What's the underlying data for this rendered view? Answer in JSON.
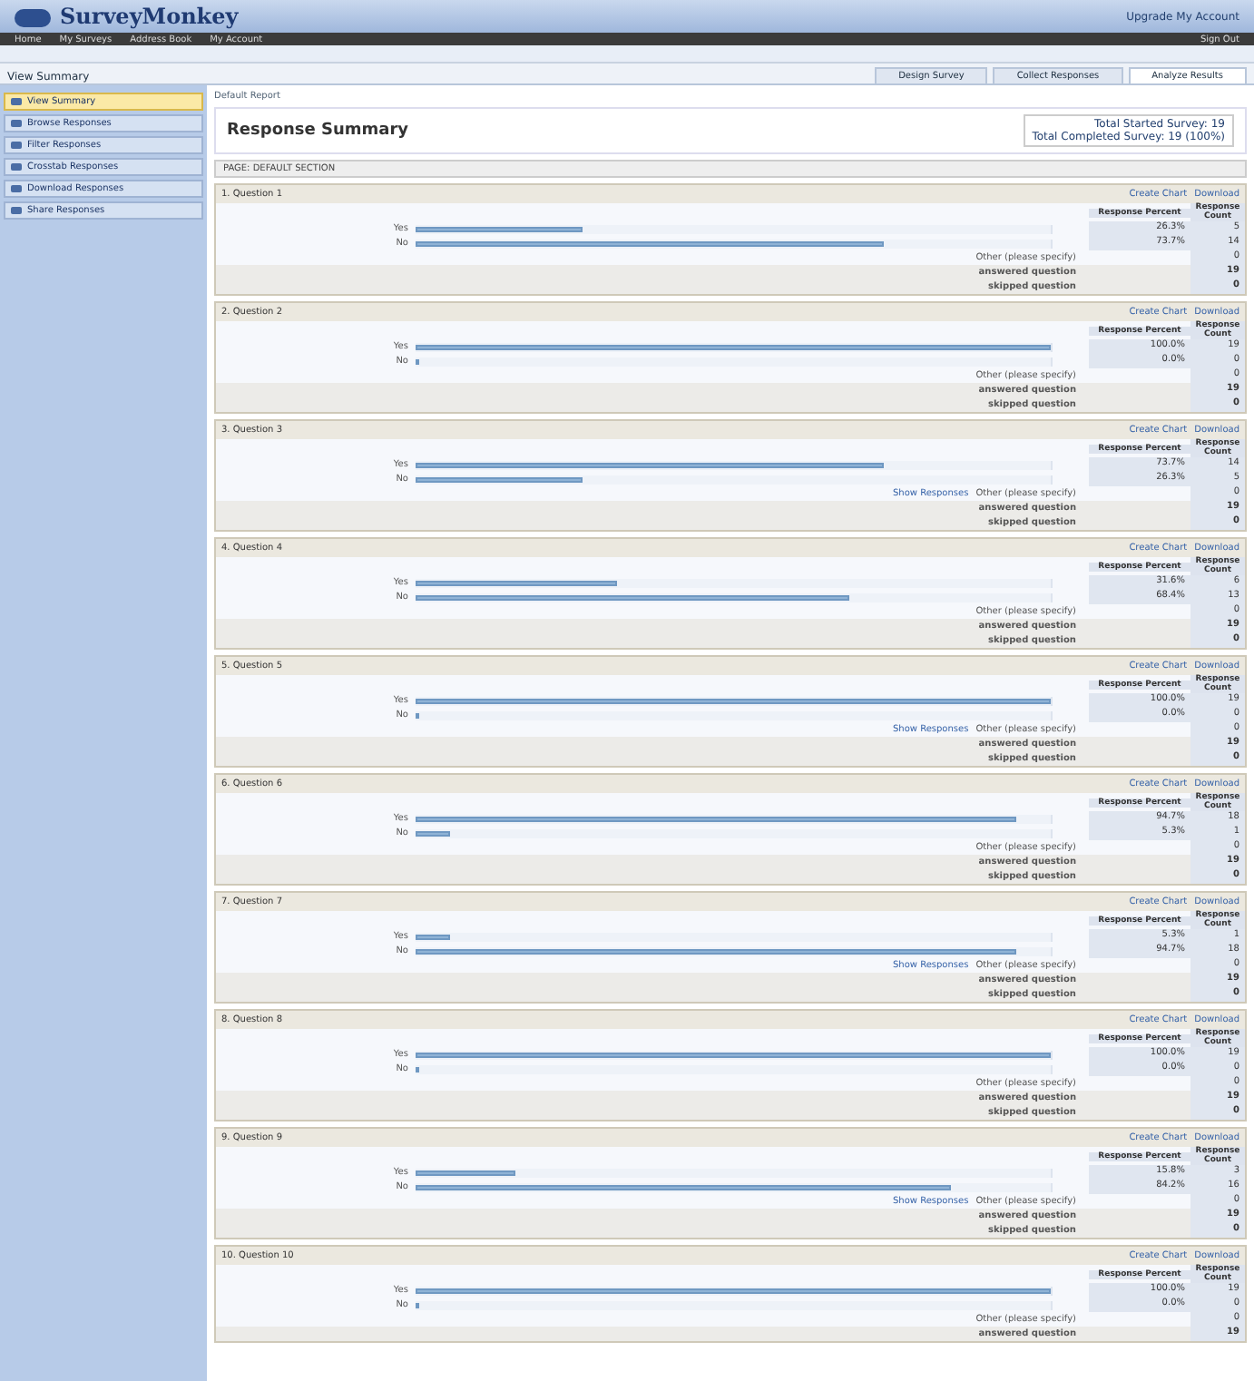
{
  "header": {
    "logo": "SurveyMonkey",
    "account": "Upgrade My Account",
    "nav": [
      "Home",
      "My Surveys",
      "Address Book",
      "My Account"
    ],
    "signout": "Sign Out"
  },
  "survey": {
    "title": "View Summary",
    "tabs": [
      {
        "label": "Design Survey",
        "selected": false
      },
      {
        "label": "Collect Responses",
        "selected": false
      },
      {
        "label": "Analyze Results",
        "selected": true
      }
    ]
  },
  "sidebar": {
    "items": [
      {
        "label": "View Summary",
        "selected": true
      },
      {
        "label": "Browse Responses",
        "selected": false
      },
      {
        "label": "Filter Responses",
        "selected": false
      },
      {
        "label": "Crosstab Responses",
        "selected": false
      },
      {
        "label": "Download Responses",
        "selected": false
      },
      {
        "label": "Share Responses",
        "selected": false
      }
    ]
  },
  "breadcrumb": "Default Report",
  "page_title": "Response Summary",
  "totals": [
    "Total Started Survey: 19",
    "Total Completed Survey: 19 (100%)"
  ],
  "page_label": "PAGE: DEFAULT SECTION",
  "questions": [
    {
      "title": "1. Question 1",
      "chart_link": "Create Chart",
      "download_link": "Download",
      "percent_header": "Response Percent",
      "count_header": "Response Count",
      "options": [
        {
          "label": "Yes",
          "level": 0.263,
          "percent": "26.3%",
          "count": "5"
        },
        {
          "label": "No",
          "level": 0.737,
          "percent": "73.7%",
          "count": "14"
        }
      ],
      "other_label": "Other (please specify)",
      "other_count": "0",
      "answered_label": "answered question",
      "answered": "19",
      "skipped_label": "skipped question",
      "skipped": "0"
    },
    {
      "title": "2. Question 2",
      "chart_link": "Create Chart",
      "download_link": "Download",
      "percent_header": "Response Percent",
      "count_header": "Response Count",
      "options": [
        {
          "label": "Yes",
          "level": 1,
          "percent": "100.0%",
          "count": "19"
        },
        {
          "label": "No",
          "level": 0,
          "percent": "0.0%",
          "count": "0"
        }
      ],
      "other_label": "Other (please specify)",
      "other_count": "0",
      "answered_label": "answered question",
      "answered": "19",
      "skipped_label": "skipped question",
      "skipped": "0"
    },
    {
      "title": "3. Question 3",
      "chart_link": "Create Chart",
      "download_link": "Download",
      "percent_header": "Response Percent",
      "count_header": "Response Count",
      "options": [
        {
          "label": "Yes",
          "level": 0.737,
          "percent": "73.7%",
          "count": "14"
        },
        {
          "label": "No",
          "level": 0.263,
          "percent": "26.3%",
          "count": "5"
        }
      ],
      "replies_link": "Show Responses",
      "other_label": "Other (please specify)",
      "other_count": "0",
      "answered_label": "answered question",
      "answered": "19",
      "skipped_label": "skipped question",
      "skipped": "0"
    },
    {
      "title": "4. Question 4",
      "chart_link": "Create Chart",
      "download_link": "Download",
      "percent_header": "Response Percent",
      "count_header": "Response Count",
      "options": [
        {
          "label": "Yes",
          "level": 0.316,
          "percent": "31.6%",
          "count": "6"
        },
        {
          "label": "No",
          "level": 0.684,
          "percent": "68.4%",
          "count": "13"
        }
      ],
      "other_label": "Other (please specify)",
      "other_count": "0",
      "answered_label": "answered question",
      "answered": "19",
      "skipped_label": "skipped question",
      "skipped": "0"
    },
    {
      "title": "5. Question 5",
      "chart_link": "Create Chart",
      "download_link": "Download",
      "percent_header": "Response Percent",
      "count_header": "Response Count",
      "options": [
        {
          "label": "Yes",
          "level": 1,
          "percent": "100.0%",
          "count": "19"
        },
        {
          "label": "No",
          "level": 0,
          "percent": "0.0%",
          "count": "0"
        }
      ],
      "replies_link": "Show Responses",
      "other_label": "Other (please specify)",
      "other_count": "0",
      "answered_label": "answered question",
      "answered": "19",
      "skipped_label": "skipped question",
      "skipped": "0"
    },
    {
      "title": "6. Question 6",
      "chart_link": "Create Chart",
      "download_link": "Download",
      "percent_header": "Response Percent",
      "count_header": "Response Count",
      "options": [
        {
          "label": "Yes",
          "level": 0.947,
          "percent": "94.7%",
          "count": "18"
        },
        {
          "label": "No",
          "level": 0.053,
          "percent": "5.3%",
          "count": "1"
        }
      ],
      "other_label": "Other (please specify)",
      "other_count": "0",
      "answered_label": "answered question",
      "answered": "19",
      "skipped_label": "skipped question",
      "skipped": "0"
    },
    {
      "title": "7. Question 7",
      "chart_link": "Create Chart",
      "download_link": "Download",
      "percent_header": "Response Percent",
      "count_header": "Response Count",
      "options": [
        {
          "label": "Yes",
          "level": 0.053,
          "percent": "5.3%",
          "count": "1"
        },
        {
          "label": "No",
          "level": 0.947,
          "percent": "94.7%",
          "count": "18"
        }
      ],
      "replies_link": "Show Responses",
      "other_label": "Other (please specify)",
      "other_count": "0",
      "answered_label": "answered question",
      "answered": "19",
      "skipped_label": "skipped question",
      "skipped": "0"
    },
    {
      "title": "8. Question 8",
      "chart_link": "Create Chart",
      "download_link": "Download",
      "percent_header": "Response Percent",
      "count_header": "Response Count",
      "options": [
        {
          "label": "Yes",
          "level": 1,
          "percent": "100.0%",
          "count": "19"
        },
        {
          "label": "No",
          "level": 0,
          "percent": "0.0%",
          "count": "0"
        }
      ],
      "other_label": "Other (please specify)",
      "other_count": "0",
      "answered_label": "answered question",
      "answered": "19",
      "skipped_label": "skipped question",
      "skipped": "0"
    },
    {
      "title": "9. Question 9",
      "chart_link": "Create Chart",
      "download_link": "Download",
      "percent_header": "Response Percent",
      "count_header": "Response Count",
      "options": [
        {
          "label": "Yes",
          "level": 0.158,
          "percent": "15.8%",
          "count": "3"
        },
        {
          "label": "No",
          "level": 0.842,
          "percent": "84.2%",
          "count": "16"
        }
      ],
      "replies_link": "Show Responses",
      "other_label": "Other (please specify)",
      "other_count": "0",
      "answered_label": "answered question",
      "answered": "19",
      "skipped_label": "skipped question",
      "skipped": "0"
    },
    {
      "title": "10. Question 10",
      "chart_link": "Create Chart",
      "download_link": "Download",
      "percent_header": "Response Percent",
      "count_header": "Response Count",
      "options": [
        {
          "label": "Yes",
          "level": 1,
          "percent": "100.0%",
          "count": "19"
        },
        {
          "label": "No",
          "level": 0,
          "percent": "0.0%",
          "count": "0"
        }
      ],
      "other_label": "Other (please specify)",
      "other_count": "0",
      "answered_label": "answered question",
      "answered": "19"
    }
  ]
}
